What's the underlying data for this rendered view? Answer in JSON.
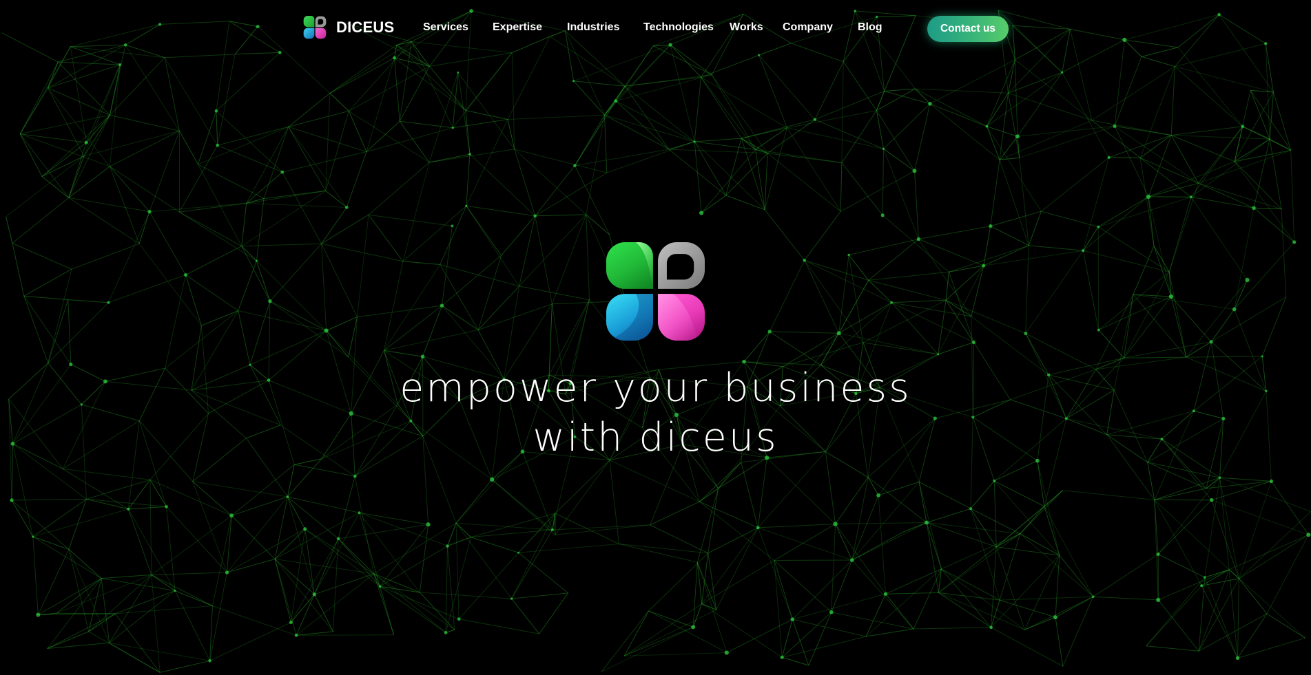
{
  "header": {
    "brand_name": "DICEUS",
    "nav": [
      {
        "label": "Services"
      },
      {
        "label": "Expertise"
      },
      {
        "label": "Industries"
      },
      {
        "label": "Technologies"
      },
      {
        "label": "Works"
      },
      {
        "label": "Company"
      },
      {
        "label": "Blog"
      }
    ],
    "contact_label": "Contact us"
  },
  "hero": {
    "title_line1": "empower your business",
    "title_line2": "with diceus"
  },
  "colors": {
    "background": "#000000",
    "network": "#2db52d",
    "accent_start": "#1e9c86",
    "accent_end": "#58cc6a",
    "logo_green": "#2ecc40",
    "logo_gray": "#8c8c8c",
    "logo_blue": "#1aa3d9",
    "logo_pink": "#e838b8"
  },
  "icons": {
    "brand": "diceus-clover-icon",
    "hero": "diceus-clover-icon"
  }
}
